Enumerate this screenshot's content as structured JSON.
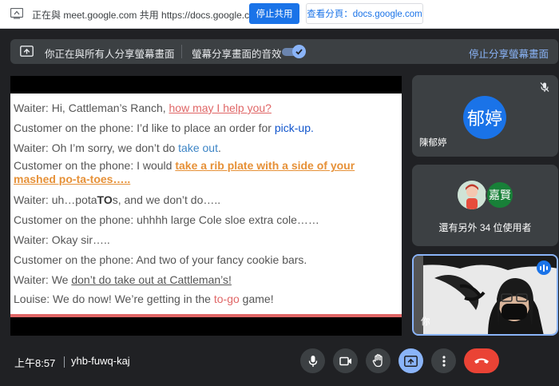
{
  "sharebar": {
    "text": "正在與 meet.google.com 共用 https://docs.google.com",
    "stop_label": "停止共用",
    "view_tab_label": "查看分頁：docs.google.com"
  },
  "present_bar": {
    "sharing_text": "你正在與所有人分享螢幕畫面",
    "audio_text": "螢幕分享畫面的音效",
    "audio_enabled": true,
    "stop_link": "停止分享螢幕畫面"
  },
  "slide": {
    "lines": [
      {
        "prefix": "Waiter: Hi, Cattleman’s Ranch, ",
        "highlight": "how may I help you?",
        "suffix": ""
      },
      {
        "prefix": "Customer on the phone: I’d like to place an order for ",
        "highlight": "pick-up",
        "suffix": "."
      },
      {
        "prefix": "Waiter: Oh I’m sorry, we don’t do ",
        "highlight": "take out",
        "suffix": "."
      },
      {
        "prefix": "Customer on the phone: I would ",
        "highlight": "take a rib plate with a side of your mashed po-ta-toes…..",
        "suffix": ""
      },
      {
        "prefix": "Waiter: uh…pota",
        "highlight": "TO",
        "suffix": "s, and we don’t do….."
      },
      {
        "prefix": "Customer on the phone: uhhhh large Cole sloe extra cole……",
        "highlight": "",
        "suffix": ""
      },
      {
        "prefix": "Waiter: Okay sir…..",
        "highlight": "",
        "suffix": ""
      },
      {
        "prefix": "Customer on the phone: And two of your fancy cookie bars.",
        "highlight": "",
        "suffix": ""
      },
      {
        "prefix": "Waiter: We ",
        "highlight": "don’t do take out at Cattleman’s!",
        "suffix": ""
      },
      {
        "prefix": "Louise: We do now! We’re getting in the ",
        "highlight": "to-go",
        "suffix": " game!"
      }
    ]
  },
  "participants": {
    "main": {
      "avatar_text": "郁婷",
      "name": "陳郁婷",
      "avatar_color": "#1a73e8"
    },
    "group": {
      "avatar_b_text": "嘉賢",
      "more_text": "還有另外 34 位使用者",
      "avatar_b_color": "#188038"
    },
    "self": {
      "label": "你"
    }
  },
  "bottombar": {
    "time": "上午8:57",
    "meeting_code": "yhb-fuwq-kaj"
  }
}
